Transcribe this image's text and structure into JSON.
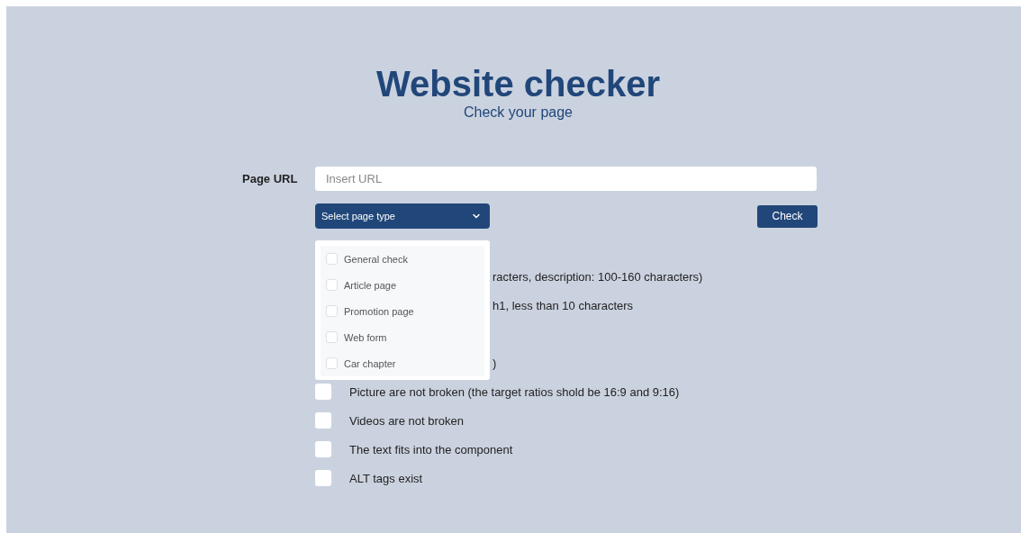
{
  "header": {
    "title": "Website checker",
    "subtitle": "Check your page"
  },
  "url_field": {
    "label": "Page URL",
    "placeholder": "Insert URL"
  },
  "page_type_select": {
    "value": "Select page type",
    "expanded": true,
    "options": [
      {
        "label": "General check",
        "checked": false
      },
      {
        "label": "Article page",
        "checked": false
      },
      {
        "label": "Promotion page",
        "checked": false
      },
      {
        "label": "Web form",
        "checked": false
      },
      {
        "label": "Car chapter",
        "checked": false
      }
    ]
  },
  "check_button": "Check",
  "checklist": [
    {
      "kind": "covered",
      "text": "racters, description: 100-160 characters)"
    },
    {
      "kind": "covered",
      "text": "h1, less than 10 characters"
    },
    {
      "kind": "covered"
    },
    {
      "kind": "covered",
      "text": ")"
    },
    {
      "kind": "checkbox",
      "text": "Picture are not broken (the target ratios shold be 16:9 and 9:16)",
      "checked": false
    },
    {
      "kind": "checkbox",
      "text": "Videos are not broken",
      "checked": false
    },
    {
      "kind": "checkbox",
      "text": "The text fits into the component",
      "checked": false
    },
    {
      "kind": "checkbox",
      "text": "ALT tags exist",
      "checked": false
    }
  ]
}
